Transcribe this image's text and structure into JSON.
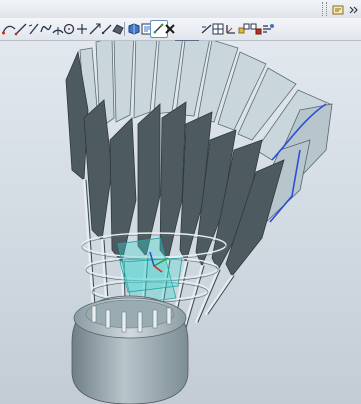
{
  "toolbar": {
    "line_width": "1",
    "tools": [
      "snap-curve-icon",
      "line-icon",
      "arc-icon",
      "spline-icon",
      "arc-center-icon",
      "circle-icon",
      "point-icon",
      "plane-icon",
      "datum-icon",
      "solid-icon",
      "sheet-icon",
      "display-icon",
      "edit-object-icon",
      "delete-icon",
      "line-width-select",
      "layer-icon",
      "grid-icon",
      "wcs-icon",
      "move-icon",
      "measure-icon",
      "analysis-icon"
    ]
  },
  "viewport": {
    "model": "shuttlecock",
    "background_top": "#e2e8ee",
    "background_bottom": "#c3ccd5",
    "feather_color": "#4d5a60",
    "feather_light_color": "#c9d6dc",
    "base_color": "#a7b6bc",
    "selection_color": "#2c4ed8",
    "highlight_color": "#3ed6d0"
  }
}
